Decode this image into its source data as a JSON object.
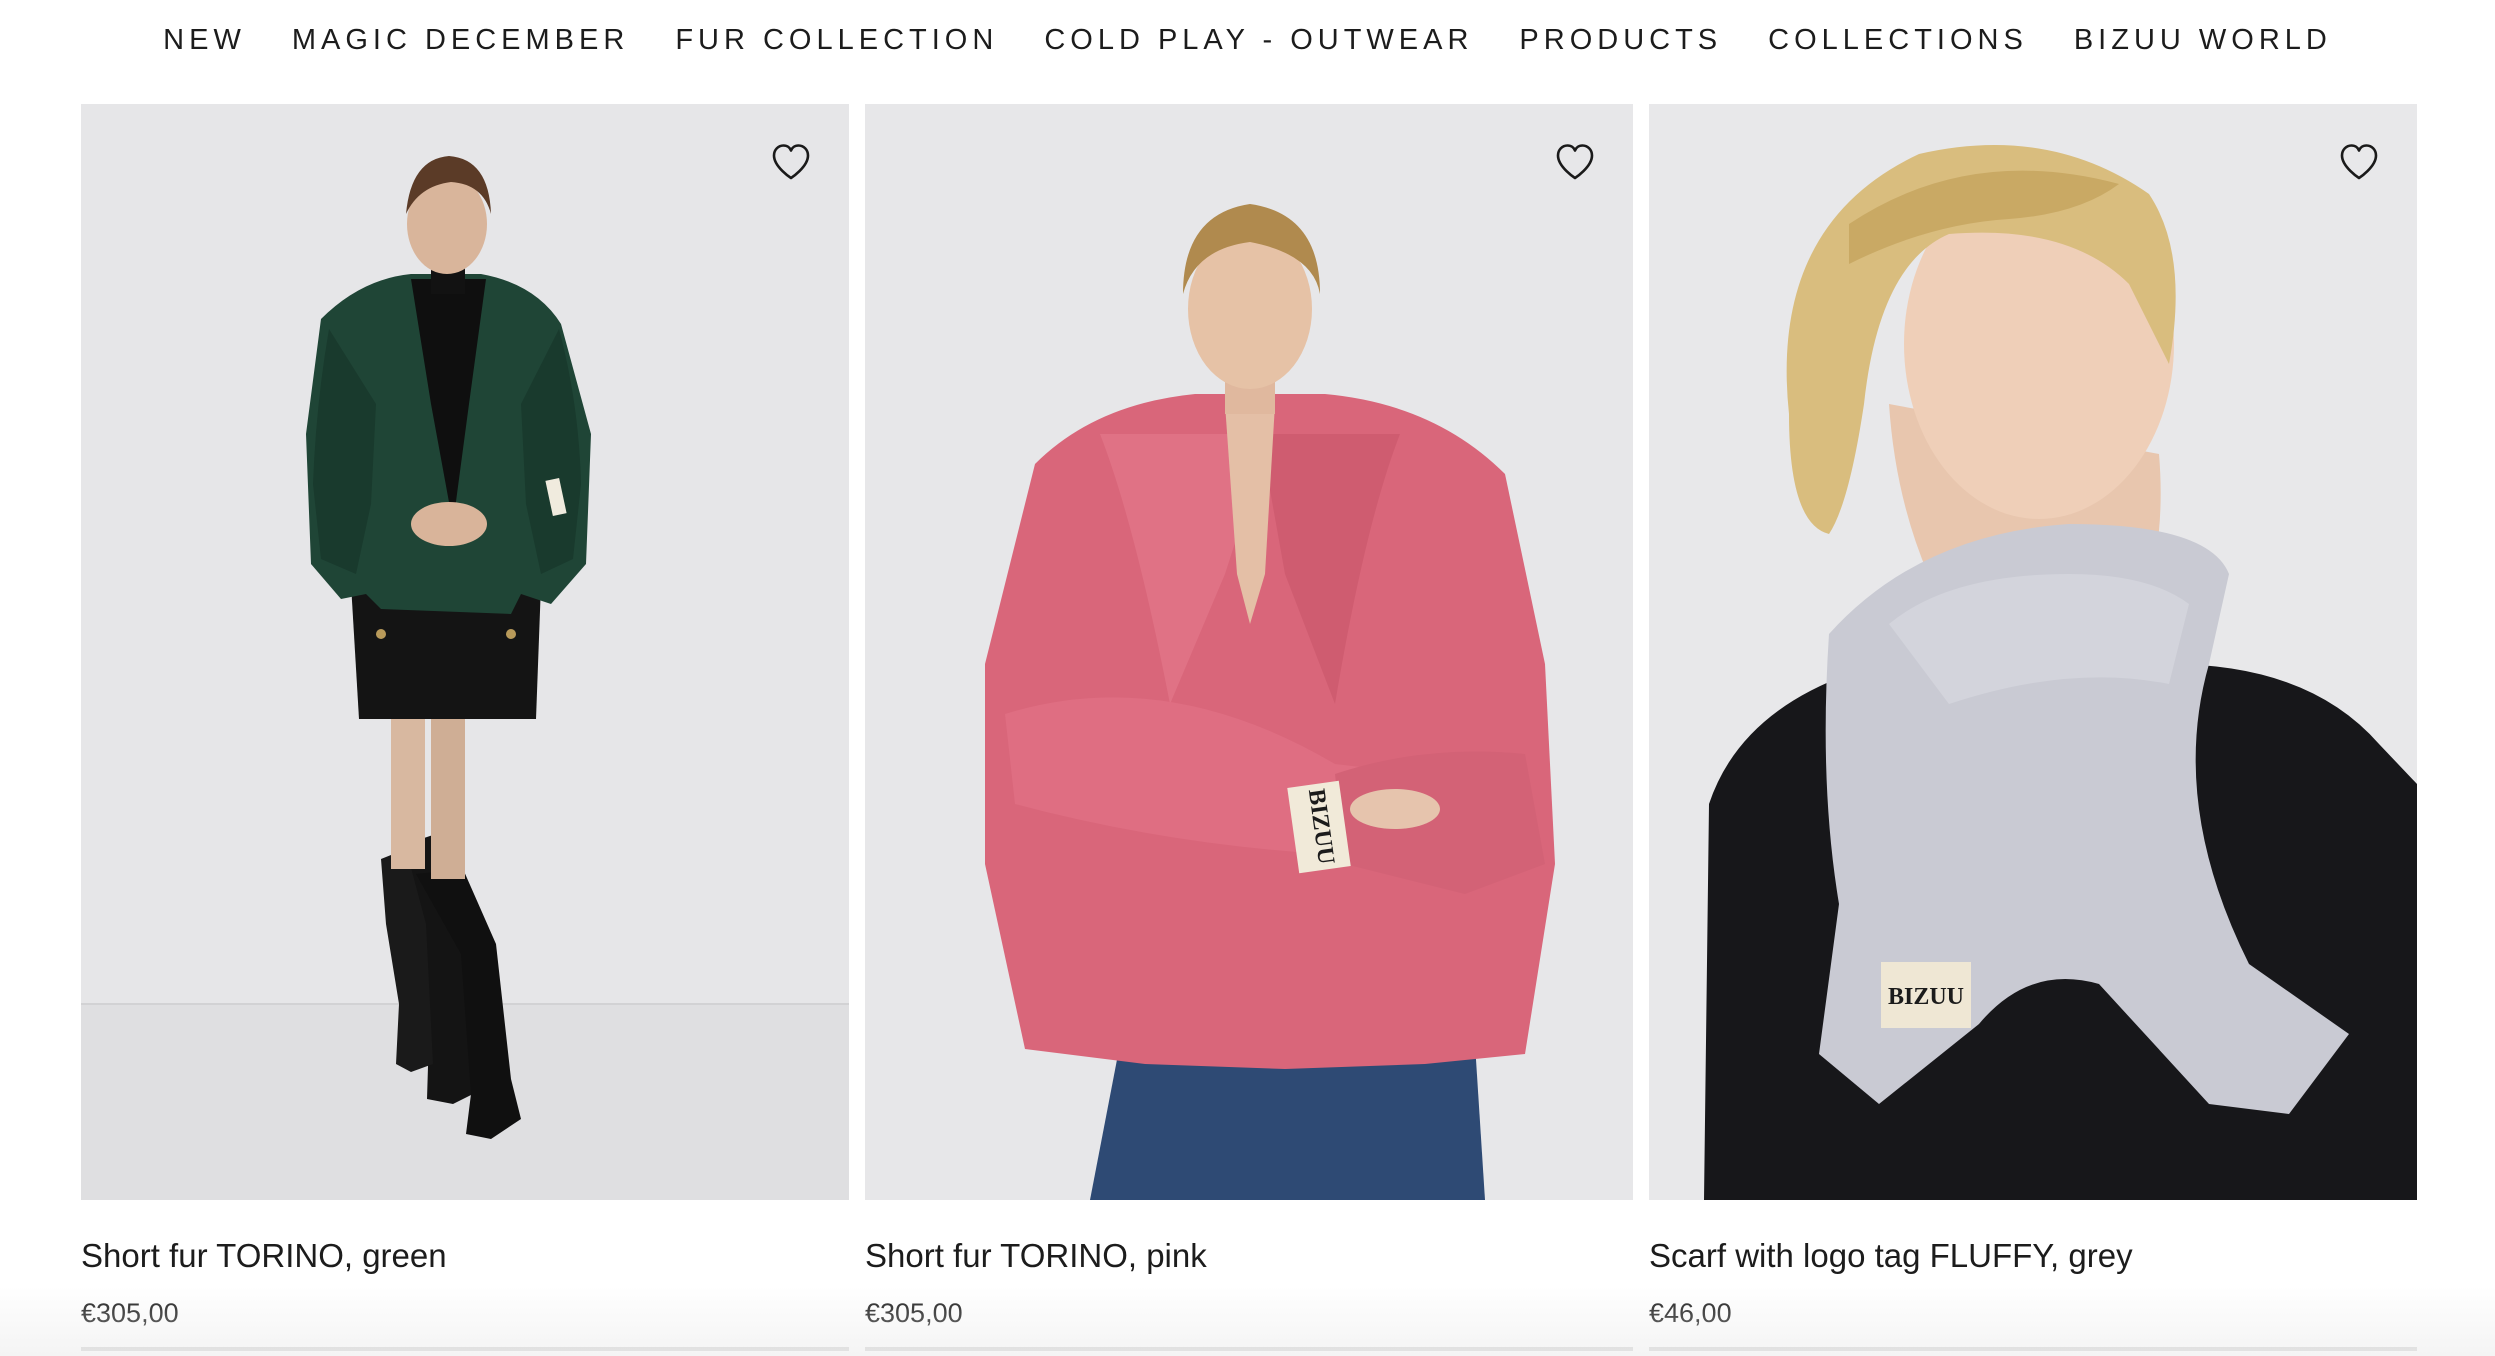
{
  "nav": {
    "items": [
      {
        "label": "NEW"
      },
      {
        "label": "MAGIC DECEMBER"
      },
      {
        "label": "FUR COLLECTION"
      },
      {
        "label": "COLD PLAY - OUTWEAR"
      },
      {
        "label": "PRODUCTS"
      },
      {
        "label": "COLLECTIONS"
      },
      {
        "label": "BIZUU WORLD"
      }
    ]
  },
  "products": [
    {
      "name": "Short fur TORINO, green",
      "price": "€305,00",
      "tag": "BIZUU",
      "wishlist_icon": "heart-outline-icon"
    },
    {
      "name": "Short fur TORINO, pink",
      "price": "€305,00",
      "tag": "BIZUU",
      "wishlist_icon": "heart-outline-icon"
    },
    {
      "name": "Scarf with logo tag FLUFFY, grey",
      "price": "€46,00",
      "tag": "BIZUU",
      "wishlist_icon": "heart-outline-icon"
    }
  ],
  "colors": {
    "green_fur": "#1f4536",
    "pink_fur": "#d9667a",
    "grey_fur": "#c9cad3",
    "backdrop": "#e9e9ea"
  }
}
